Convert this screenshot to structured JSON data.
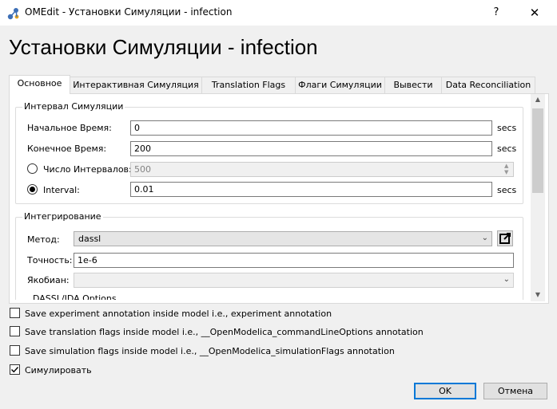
{
  "window": {
    "title": "OMEdit - Установки Симуляции - infection",
    "help_label": "?",
    "close_label": "✕"
  },
  "heading": "Установки Симуляции - infection",
  "tabs": [
    {
      "label": "Основное",
      "active": true
    },
    {
      "label": "Интерактивная Симуляция",
      "active": false
    },
    {
      "label": "Translation Flags",
      "active": false
    },
    {
      "label": "Флаги Симуляции",
      "active": false
    },
    {
      "label": "Вывести",
      "active": false
    },
    {
      "label": "Data Reconciliation",
      "active": false
    }
  ],
  "interval": {
    "group_title": "Интервал Симуляции",
    "start_label": "Начальное Время:",
    "start_value": "0",
    "stop_label": "Конечное Время:",
    "stop_value": "200",
    "intervals_label": "Число Интервалов:",
    "intervals_value": "500",
    "interval_label": "Interval:",
    "interval_value": "0.01",
    "unit": "secs"
  },
  "integration": {
    "group_title": "Интегрирование",
    "method_label": "Метод:",
    "method_value": "dassl",
    "tolerance_label": "Точность:",
    "tolerance_value": "1e-6",
    "jacobian_label": "Якобиан:",
    "jacobian_value": "",
    "dassl_options_label": "DASSL/IDA Options"
  },
  "checkboxes": [
    {
      "label": "Save experiment annotation inside model i.e., experiment annotation",
      "checked": false
    },
    {
      "label": "Save translation flags inside model i.e., __OpenModelica_commandLineOptions annotation",
      "checked": false
    },
    {
      "label": "Save simulation flags inside model i.e., __OpenModelica_simulationFlags annotation",
      "checked": false
    },
    {
      "label": "Симулировать",
      "checked": true
    }
  ],
  "buttons": {
    "ok": "OK",
    "cancel": "Отмена"
  },
  "icons": {
    "app": "omedit-logo-icon",
    "open_external": "open-external-icon"
  },
  "colors": {
    "accent": "#0078d7"
  }
}
